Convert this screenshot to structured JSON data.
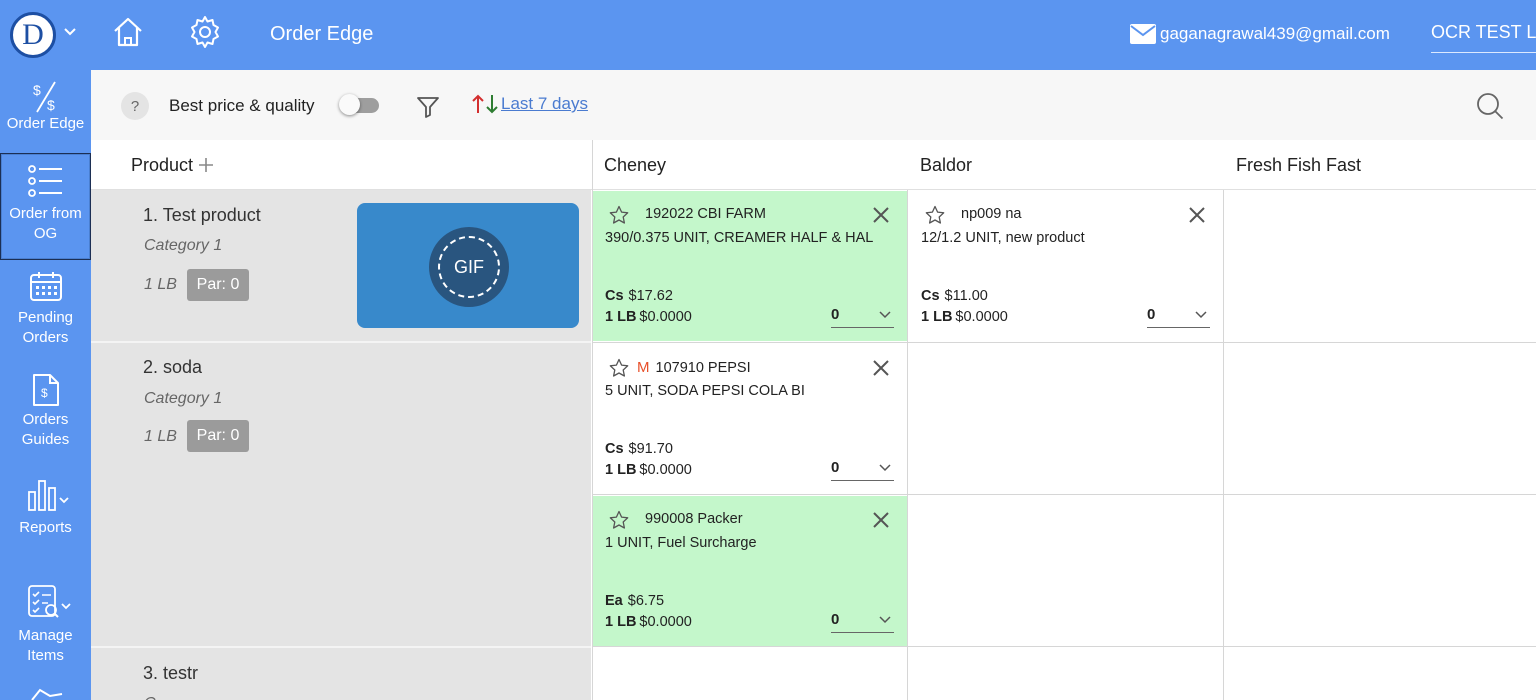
{
  "header": {
    "avatar_letter": "D",
    "app_title": "Order Edge",
    "email": "gaganagrawal439@gmail.com",
    "org": "OCR TEST L"
  },
  "sidebar": {
    "items": [
      {
        "label": "Order Edge",
        "icon": "dollar-swap-icon"
      },
      {
        "label": "Order from OG",
        "icon": "list-icon"
      },
      {
        "label": "Pending Orders",
        "icon": "calendar-icon"
      },
      {
        "label": "Orders Guides",
        "icon": "document-dollar-icon"
      },
      {
        "label": "Reports",
        "icon": "bar-chart-icon"
      },
      {
        "label": "Manage Items",
        "icon": "checklist-search-icon"
      }
    ]
  },
  "toolbar": {
    "help": "?",
    "best_price_label": "Best price & quality",
    "period": "Last 7 days"
  },
  "columns": {
    "product": "Product",
    "vendors": [
      "Cheney",
      "Baldor",
      "Fresh Fish Fast"
    ]
  },
  "products": [
    {
      "name": "1. Test product",
      "category": "Category 1",
      "unit": "1 LB",
      "par": "Par: 0",
      "image_label": "GIF"
    },
    {
      "name": "2. soda",
      "category": "Category 1",
      "unit": "1 LB",
      "par": "Par: 0"
    },
    {
      "name": "3. testr",
      "category": "C"
    }
  ],
  "offers": [
    {
      "code": "192022 CBI FARM",
      "desc": "390/0.375 UNIT, CREAMER HALF & HAL",
      "pack": "Cs",
      "price": "$17.62",
      "unit": "1 LB",
      "unit_price": "$0.0000",
      "qty": "0"
    },
    {
      "code": "np009 na",
      "desc": "12/1.2 UNIT, new product",
      "pack": "Cs",
      "price": "$11.00",
      "unit": "1 LB",
      "unit_price": "$0.0000",
      "qty": "0"
    },
    {
      "mark": "M",
      "code": "107910 PEPSI",
      "desc": "5 UNIT, SODA PEPSI COLA BI",
      "pack": "Cs",
      "price": "$91.70",
      "unit": "1 LB",
      "unit_price": "$0.0000",
      "qty": "0"
    },
    {
      "code": "990008 Packer",
      "desc": "1 UNIT, Fuel Surcharge",
      "pack": "Ea",
      "price": "$6.75",
      "unit": "1 LB",
      "unit_price": "$0.0000",
      "qty": "0"
    }
  ],
  "colors": {
    "accent": "#5b95f0",
    "best_offer": "#c4f7cb",
    "product_bg": "#e4e4e4",
    "par_badge": "#9b9b9b"
  }
}
